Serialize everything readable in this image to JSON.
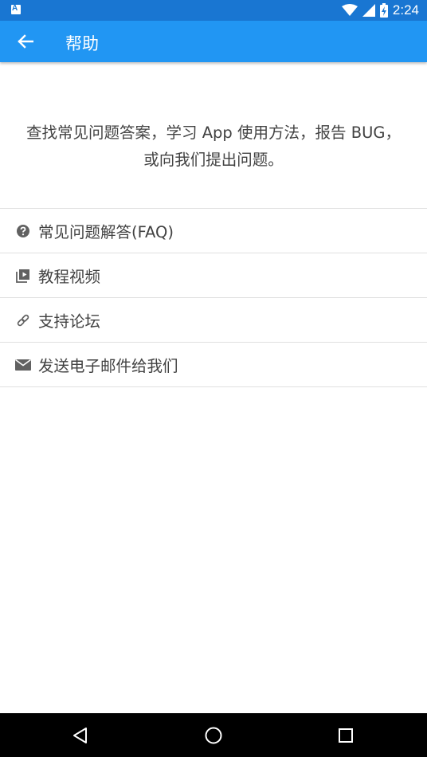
{
  "status_bar": {
    "time": "2:24",
    "icons": [
      "notification-a-icon",
      "wifi-icon",
      "cellular-signal-icon",
      "battery-charging-icon"
    ]
  },
  "app_bar": {
    "title": "帮助",
    "back_icon": "arrow-back-icon",
    "color": "#2196f3"
  },
  "description": {
    "line1": "查找常见问题答案，学习 App 使用方法，报告 BUG，",
    "line2": "或向我们提出问题。"
  },
  "menu": {
    "items": [
      {
        "label": "常见问题解答(FAQ)",
        "icon": "help-circle-icon"
      },
      {
        "label": "教程视频",
        "icon": "video-library-icon"
      },
      {
        "label": "支持论坛",
        "icon": "link-icon"
      },
      {
        "label": "发送电子邮件给我们",
        "icon": "email-icon"
      }
    ]
  },
  "nav_bar": {
    "buttons": [
      "back-triangle-icon",
      "home-circle-icon",
      "recents-square-icon"
    ]
  }
}
